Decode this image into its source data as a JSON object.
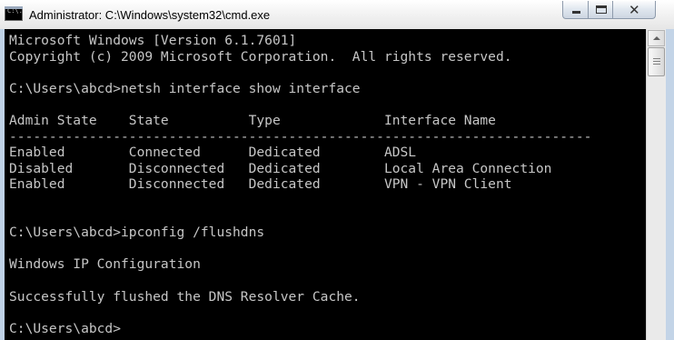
{
  "window": {
    "title": "Administrator: C:\\Windows\\system32\\cmd.exe",
    "icon_text": "C:\\.",
    "icons": [
      "cmd-icon",
      "minimize-icon",
      "maximize-icon",
      "close-icon"
    ]
  },
  "console": {
    "lines": [
      "Microsoft Windows [Version 6.1.7601]",
      "Copyright (c) 2009 Microsoft Corporation.  All rights reserved.",
      "",
      "C:\\Users\\abcd>netsh interface show interface",
      "",
      "Admin State    State          Type             Interface Name",
      "-------------------------------------------------------------------------",
      "Enabled        Connected      Dedicated        ADSL",
      "Disabled       Disconnected   Dedicated        Local Area Connection",
      "Enabled        Disconnected   Dedicated        VPN - VPN Client",
      "",
      "",
      "C:\\Users\\abcd>ipconfig /flushdns",
      "",
      "Windows IP Configuration",
      "",
      "Successfully flushed the DNS Resolver Cache.",
      "",
      "C:\\Users\\abcd>"
    ]
  },
  "colors": {
    "console_background": "#000000",
    "console_text": "#c6c6c6",
    "frame": "#bfd2e6"
  }
}
